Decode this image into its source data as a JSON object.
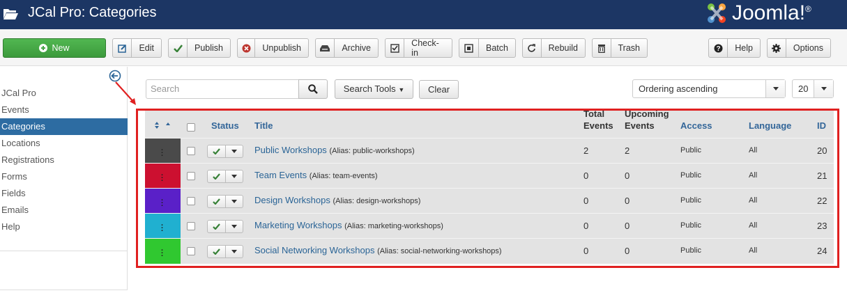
{
  "header": {
    "title": "JCal Pro: Categories",
    "logo_text": "Joomla!",
    "logo_mark": "®"
  },
  "toolbar": {
    "buttons": [
      {
        "label": "New",
        "icon": "plus-circle-icon"
      },
      {
        "label": "Edit",
        "icon": "edit-icon"
      },
      {
        "label": "Publish",
        "icon": "check-icon"
      },
      {
        "label": "Unpublish",
        "icon": "times-circle-icon"
      },
      {
        "label": "Archive",
        "icon": "archive-icon"
      },
      {
        "label": "Check-in",
        "icon": "checkbox-icon"
      },
      {
        "label": "Batch",
        "icon": "batch-icon"
      },
      {
        "label": "Rebuild",
        "icon": "refresh-icon"
      },
      {
        "label": "Trash",
        "icon": "trash-icon"
      },
      {
        "label": "Help",
        "icon": "question-icon"
      },
      {
        "label": "Options",
        "icon": "gear-icon"
      }
    ]
  },
  "sidebar": {
    "items": [
      {
        "label": "JCal Pro",
        "active": false
      },
      {
        "label": "Events",
        "active": false
      },
      {
        "label": "Categories",
        "active": true
      },
      {
        "label": "Locations",
        "active": false
      },
      {
        "label": "Registrations",
        "active": false
      },
      {
        "label": "Forms",
        "active": false
      },
      {
        "label": "Fields",
        "active": false
      },
      {
        "label": "Emails",
        "active": false
      },
      {
        "label": "Help",
        "active": false
      }
    ]
  },
  "filters": {
    "search_placeholder": "Search",
    "search_tools_label": "Search Tools",
    "clear_label": "Clear",
    "ordering_value": "Ordering ascending",
    "limit_value": "20"
  },
  "table": {
    "headers": {
      "status": "Status",
      "title": "Title",
      "total_events_1": "Total",
      "total_events_2": "Events",
      "upcoming_events_1": "Upcoming",
      "upcoming_events_2": "Events",
      "access": "Access",
      "language": "Language",
      "id": "ID"
    },
    "rows": [
      {
        "color": "#4a4a4a",
        "title": "Public Workshops",
        "alias": "(Alias: public-workshops)",
        "total": "2",
        "upcoming": "2",
        "access": "Public",
        "language": "All",
        "id": "20"
      },
      {
        "color": "#cc1030",
        "title": "Team Events",
        "alias": "(Alias: team-events)",
        "total": "0",
        "upcoming": "0",
        "access": "Public",
        "language": "All",
        "id": "21"
      },
      {
        "color": "#5a20c8",
        "title": "Design Workshops",
        "alias": "(Alias: design-workshops)",
        "total": "0",
        "upcoming": "0",
        "access": "Public",
        "language": "All",
        "id": "22"
      },
      {
        "color": "#20b0d0",
        "title": "Marketing Workshops",
        "alias": "(Alias: marketing-workshops)",
        "total": "0",
        "upcoming": "0",
        "access": "Public",
        "language": "All",
        "id": "23"
      },
      {
        "color": "#30c830",
        "title": "Social Networking Workshops",
        "alias": "(Alias: social-networking-workshops)",
        "total": "0",
        "upcoming": "0",
        "access": "Public",
        "language": "All",
        "id": "24"
      }
    ]
  },
  "colors": {
    "header_bg": "#1c3664",
    "new_button": "#46a546",
    "active_sidebar": "#2d6ca2",
    "highlight_frame": "#e02020"
  }
}
